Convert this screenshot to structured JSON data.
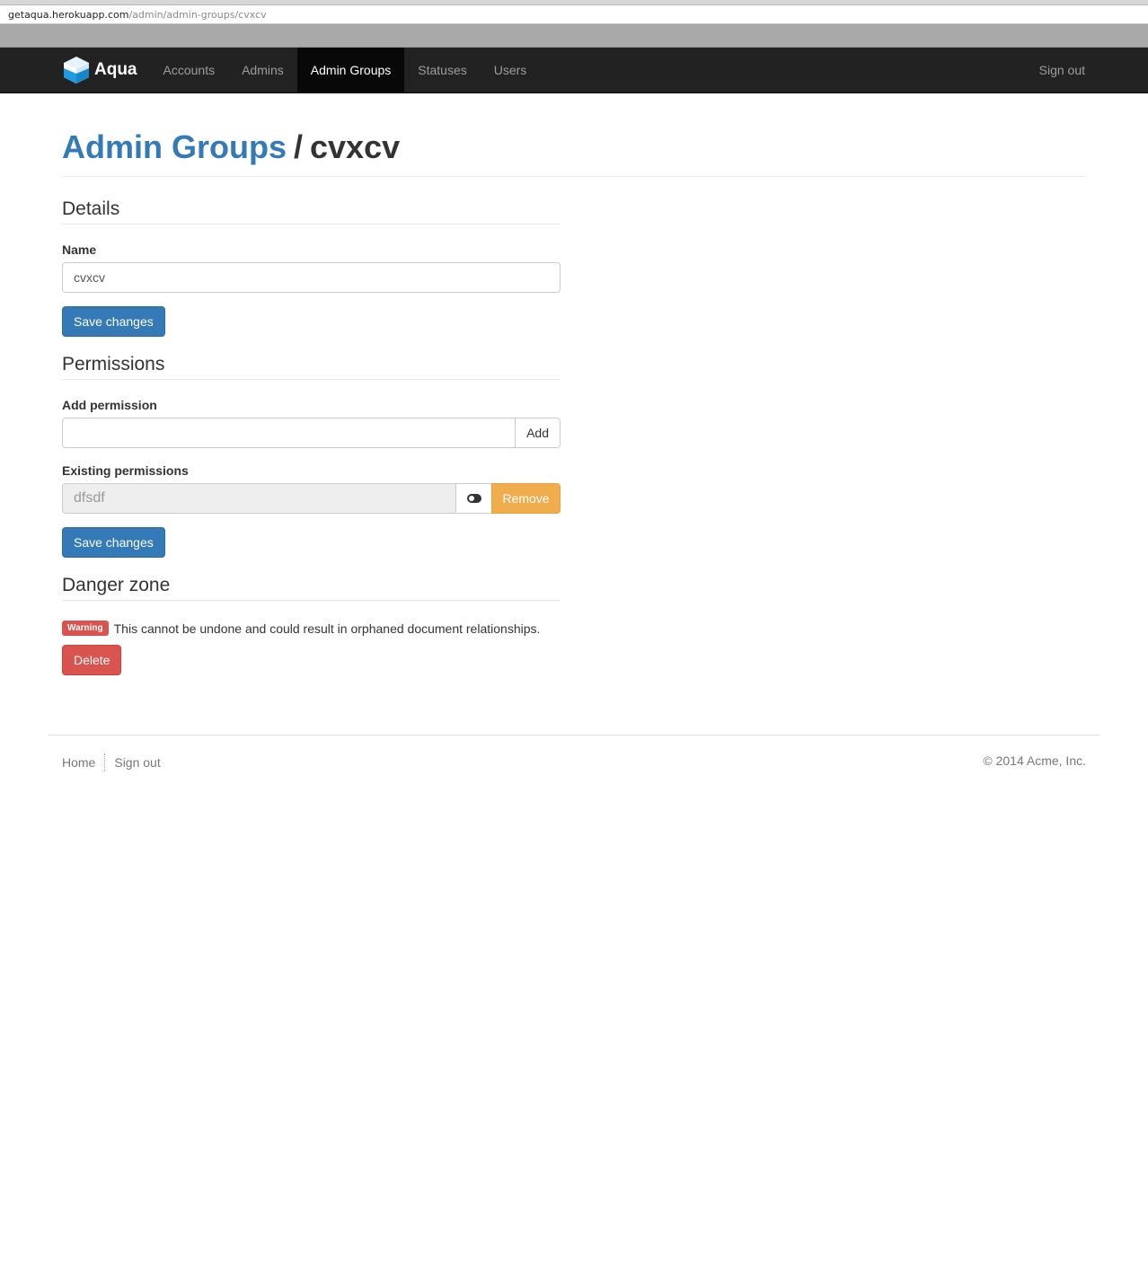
{
  "browser": {
    "url_host": "getaqua.herokuapp.com",
    "url_path": "/admin/admin-groups/cvxcv"
  },
  "navbar": {
    "brand": "Aqua",
    "items": [
      {
        "label": "Accounts"
      },
      {
        "label": "Admins"
      },
      {
        "label": "Admin Groups"
      },
      {
        "label": "Statuses"
      },
      {
        "label": "Users"
      }
    ],
    "sign_out": "Sign out"
  },
  "header": {
    "parent": "Admin Groups",
    "separator": "/",
    "current": "cvxcv"
  },
  "details": {
    "legend": "Details",
    "name_label": "Name",
    "name_value": "cvxcv",
    "save_label": "Save changes"
  },
  "permissions": {
    "legend": "Permissions",
    "add_label": "Add permission",
    "add_button": "Add",
    "existing_label": "Existing permissions",
    "existing": [
      {
        "name": "dfsdf",
        "remove_label": "Remove"
      }
    ],
    "save_label": "Save changes"
  },
  "danger": {
    "legend": "Danger zone",
    "badge": "Warning",
    "message": "This cannot be undone and could result in orphaned document relationships.",
    "delete_label": "Delete"
  },
  "footer": {
    "home": "Home",
    "sign_out": "Sign out",
    "copyright": "© 2014 Acme, Inc."
  },
  "colors": {
    "navbar_bg": "#222222",
    "primary": "#337ab7",
    "danger": "#d9534f",
    "warning": "#f0ad4e"
  }
}
